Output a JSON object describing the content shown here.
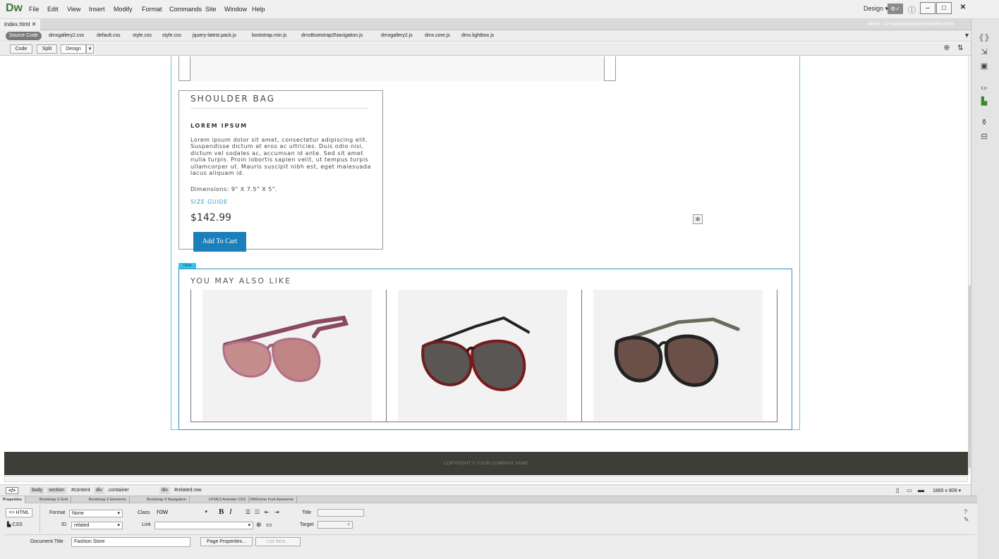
{
  "app": {
    "logo": "Dw",
    "menus": [
      "File",
      "Edit",
      "View",
      "Insert",
      "Modify",
      "Format",
      "Commands",
      "Site",
      "Window",
      "Help"
    ],
    "workspace": "Design"
  },
  "document": {
    "tab": "index.html",
    "path": "demo - D:\\wamp\\www\\demo\\index.html"
  },
  "related_files": {
    "source": "Source Code",
    "files": [
      "dmxgallery2.css",
      "default.css",
      "style.css",
      "style.css",
      "jquery-latest.pack.js",
      "bootstrap.min.js",
      "dmxBootstrap3Navigation.js",
      "dmxgallery2.js",
      "dmx.core.js",
      "dmx.lightbox.js"
    ]
  },
  "view": {
    "code": "Code",
    "split": "Split",
    "design": "Design"
  },
  "product": {
    "title": "SHOULDER BAG",
    "subtitle": "LOREM IPSUM",
    "description": "Lorem ipsum dolor sit amet, consectetur adipiscing elit. Suspendisse dictum at eros ac ultricies. Duis odio nisi, dictum vel sodales ac, accumsan id ante. Sed sit amet nulla turpis. Proin lobortis sapien velit, ut tempus turpis ullamcorper ut. Mauris suscipit nibh est, eget malesuada lacus aliquam id.",
    "dimensions": "Dimensions: 9\" X 7.5\" X 5\".",
    "size_guide": "SIZE GUIDE",
    "price": "$142.99",
    "cart": "Add To Cart"
  },
  "related": {
    "tag": "/ Row",
    "title": "YOU MAY ALSO LIKE"
  },
  "footer": {
    "copyright": "COPYRIGHT © YOUR COMPANY NAME"
  },
  "tag_selector": {
    "code": "</>",
    "tags": [
      "body",
      "section",
      "#content",
      "div",
      ".container",
      "div",
      "#related.row"
    ],
    "size": "1865 x 809"
  },
  "panels": {
    "tabs": [
      "Properties",
      "Bootstrap 3 Grid",
      "Bootstrap 3 Elements",
      "Bootstrap 3 Navigation",
      "HTML5 Animate CSS",
      "DMXzone Font Awesome"
    ]
  },
  "properties": {
    "html": "HTML",
    "css": "CSS",
    "format_label": "Format",
    "format_value": "None",
    "class_label": "Class",
    "class_value": "row",
    "id_label": "ID",
    "id_value": "related",
    "link_label": "Link",
    "title_label": "Title",
    "target_label": "Target",
    "doc_title_label": "Document Title",
    "doc_title_value": "Fashion Store",
    "page_props": "Page Properties...",
    "list_item": "List Item..."
  }
}
